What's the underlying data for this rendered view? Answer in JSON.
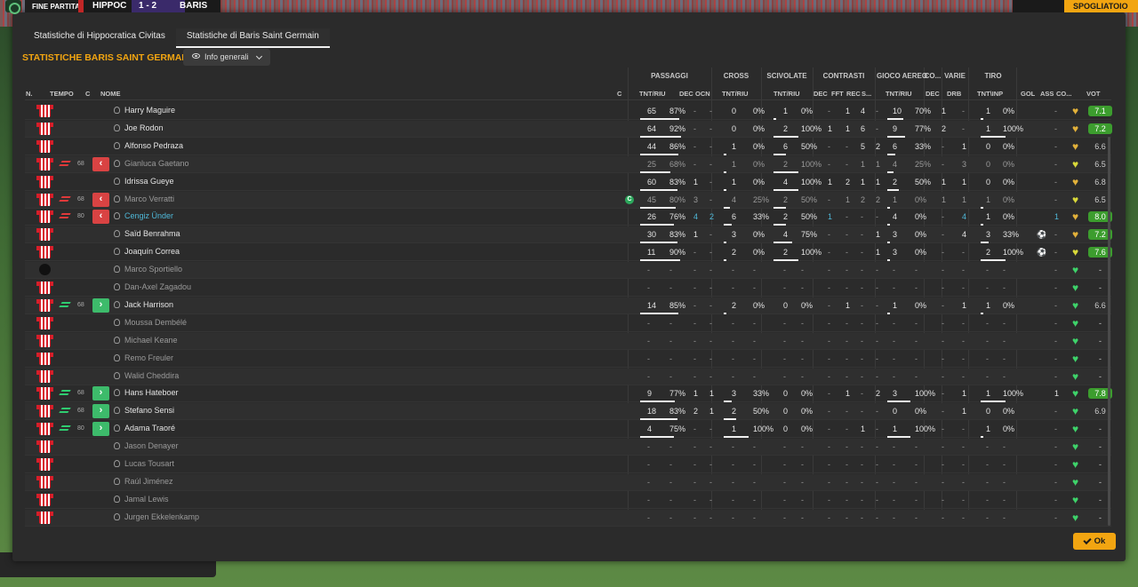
{
  "topbar": {
    "status": "FINE PARTITA",
    "home": "HIPPOC",
    "score": "1 - 2",
    "away": "BARIS",
    "right_btn": "SPOGLIATOIO"
  },
  "tabs": [
    {
      "label": "Statistiche di Hippocratica Civitas"
    },
    {
      "label": "Statistiche di Baris Saint Germain"
    }
  ],
  "title": "STATISTICHE BARIS SAINT GERMAIN",
  "dropdown": {
    "label": "Info generali"
  },
  "groups": [
    "PASSAGGI",
    "CROSS",
    "SCIVOLATE",
    "CONTRASTI",
    "GIOCO AEREO",
    "CO...",
    "VARIE",
    "TIRO"
  ],
  "headers": {
    "n": "N.",
    "tempo": "TEMPO",
    "c": "C",
    "nome": "NOME",
    "c2": "C",
    "pass": "TNT/RIU",
    "dec": "DEC",
    "ocn": "OCN",
    "cross": "TNT/RIU",
    "sciv": "TNT/RIU",
    "cdec": "DEC",
    "fft": "FFT",
    "rec": "REC",
    "s": "S...",
    "aereo": "TNT/RIU",
    "codec": "DEC",
    "drb": "DRB",
    "tiro": "TNT\\INP",
    "gol": "GOL",
    "ass": "ASS",
    "co": "CO...",
    "vot": "VOT"
  },
  "ok_label": "Ok",
  "players": [
    {
      "name": "Harry Maguire",
      "sub": "",
      "min": "",
      "pass": [
        "65",
        "87%"
      ],
      "dec": "-",
      "ocn": "-",
      "cross": [
        "0",
        "0%"
      ],
      "sciv": [
        "1",
        "0%"
      ],
      "cdec": "-",
      "fft": "1",
      "rec": "4",
      "s": "-",
      "air": [
        "10",
        "70%"
      ],
      "codec": "1",
      "drb": "-",
      "tiro": [
        "1",
        "0%"
      ],
      "gol": "",
      "ass": "-",
      "hc": "#e2b13a",
      "vot": "7.1",
      "vc": "good"
    },
    {
      "name": "Joe Rodon",
      "sub": "",
      "min": "",
      "pass": [
        "64",
        "92%"
      ],
      "dec": "-",
      "ocn": "-",
      "cross": [
        "0",
        "0%"
      ],
      "sciv": [
        "2",
        "100%"
      ],
      "cdec": "1",
      "fft": "1",
      "rec": "6",
      "s": "-",
      "air": [
        "9",
        "77%"
      ],
      "codec": "2",
      "drb": "-",
      "tiro": [
        "1",
        "100%"
      ],
      "gol": "",
      "ass": "-",
      "hc": "#e2b13a",
      "vot": "7.2",
      "vc": "good"
    },
    {
      "name": "Alfonso Pedraza",
      "sub": "",
      "min": "",
      "pass": [
        "44",
        "86%"
      ],
      "dec": "-",
      "ocn": "-",
      "cross": [
        "1",
        "0%"
      ],
      "sciv": [
        "6",
        "50%"
      ],
      "cdec": "-",
      "fft": "-",
      "rec": "5",
      "s": "2",
      "air": [
        "6",
        "33%"
      ],
      "codec": "-",
      "drb": "1",
      "tiro": [
        "0",
        "0%"
      ],
      "gol": "",
      "ass": "-",
      "hc": "#e2b13a",
      "vot": "6.6",
      "vc": "mid"
    },
    {
      "name": "Gianluca Gaetano",
      "sub": "out",
      "min": "68",
      "pass": [
        "25",
        "68%"
      ],
      "dec": "-",
      "ocn": "-",
      "cross": [
        "1",
        "0%"
      ],
      "sciv": [
        "2",
        "100%"
      ],
      "cdec": "-",
      "fft": "-",
      "rec": "1",
      "s": "1",
      "air": [
        "4",
        "25%"
      ],
      "codec": "-",
      "drb": "3",
      "tiro": [
        "0",
        "0%"
      ],
      "gol": "",
      "ass": "-",
      "hc": "#d9d93a",
      "vot": "6.5",
      "vc": "mid"
    },
    {
      "name": "Idrissa Gueye",
      "sub": "",
      "min": "",
      "pass": [
        "60",
        "83%"
      ],
      "dec": "1",
      "ocn": "-",
      "cross": [
        "1",
        "0%"
      ],
      "sciv": [
        "4",
        "100%"
      ],
      "cdec": "1",
      "fft": "2",
      "rec": "1",
      "s": "1",
      "air": [
        "2",
        "50%"
      ],
      "codec": "1",
      "drb": "1",
      "tiro": [
        "0",
        "0%"
      ],
      "gol": "",
      "ass": "-",
      "hc": "#e2b13a",
      "vot": "6.8",
      "vc": "mid"
    },
    {
      "name": "Marco Verratti",
      "sub": "out",
      "min": "68",
      "pass": [
        "45",
        "80%"
      ],
      "dec": "3",
      "ocn": "-",
      "cross": [
        "4",
        "25%"
      ],
      "sciv": [
        "2",
        "50%"
      ],
      "cdec": "-",
      "fft": "1",
      "rec": "2",
      "s": "2",
      "air": [
        "1",
        "0%"
      ],
      "codec": "1",
      "drb": "1",
      "tiro": [
        "1",
        "0%"
      ],
      "gol": "",
      "ass": "-",
      "hc": "#d9d93a",
      "vot": "6.5",
      "vc": "mid"
    },
    {
      "name": "Cengiz Ünder",
      "sub": "out",
      "min": "80",
      "pass": [
        "26",
        "76%"
      ],
      "dec": "4",
      "ocn": "2",
      "cross": [
        "6",
        "33%"
      ],
      "sciv": [
        "2",
        "50%"
      ],
      "cdec": "1",
      "fft": "-",
      "rec": "-",
      "s": "-",
      "air": [
        "4",
        "0%"
      ],
      "codec": "-",
      "drb": "4",
      "tiro": [
        "1",
        "0%"
      ],
      "gol": "",
      "ass": "1",
      "hc": "#e2b13a",
      "vot": "8.0",
      "vc": "good"
    },
    {
      "name": "Saïd Benrahma",
      "sub": "",
      "min": "",
      "pass": [
        "30",
        "83%"
      ],
      "dec": "1",
      "ocn": "-",
      "cross": [
        "3",
        "0%"
      ],
      "sciv": [
        "4",
        "75%"
      ],
      "cdec": "-",
      "fft": "-",
      "rec": "-",
      "s": "1",
      "air": [
        "3",
        "0%"
      ],
      "codec": "-",
      "drb": "4",
      "tiro": [
        "3",
        "33%"
      ],
      "gol": "⚽",
      "ass": "-",
      "hc": "#e2b13a",
      "vot": "7.2",
      "vc": "good"
    },
    {
      "name": "Joaquín Correa",
      "sub": "",
      "min": "",
      "pass": [
        "11",
        "90%"
      ],
      "dec": "-",
      "ocn": "-",
      "cross": [
        "2",
        "0%"
      ],
      "sciv": [
        "2",
        "100%"
      ],
      "cdec": "-",
      "fft": "-",
      "rec": "-",
      "s": "1",
      "air": [
        "3",
        "0%"
      ],
      "codec": "-",
      "drb": "-",
      "tiro": [
        "2",
        "100%"
      ],
      "gol": "⚽",
      "ass": "-",
      "hc": "#d9d93a",
      "vot": "7.6",
      "vc": "good"
    },
    {
      "name": "Marco Sportiello",
      "sub": "",
      "min": "",
      "pass": [
        "-",
        "-"
      ],
      "dec": "-",
      "ocn": "-",
      "cross": [
        "-",
        "-"
      ],
      "sciv": [
        "-",
        "-"
      ],
      "cdec": "-",
      "fft": "-",
      "rec": "-",
      "s": "-",
      "air": [
        "-",
        "-"
      ],
      "codec": "-",
      "drb": "-",
      "tiro": [
        "-",
        "-"
      ],
      "gol": "",
      "ass": "-",
      "hc": "#3ed36a",
      "vot": "-",
      "vc": "mid",
      "gk": "12"
    },
    {
      "name": "Dan-Axel Zagadou",
      "sub": "",
      "min": "",
      "pass": [
        "-",
        "-"
      ],
      "dec": "-",
      "ocn": "-",
      "cross": [
        "-",
        "-"
      ],
      "sciv": [
        "-",
        "-"
      ],
      "cdec": "-",
      "fft": "-",
      "rec": "-",
      "s": "-",
      "air": [
        "-",
        "-"
      ],
      "codec": "-",
      "drb": "-",
      "tiro": [
        "-",
        "-"
      ],
      "gol": "",
      "ass": "-",
      "hc": "#3ed36a",
      "vot": "-",
      "vc": "mid"
    },
    {
      "name": "Jack Harrison",
      "sub": "in",
      "min": "68",
      "pass": [
        "14",
        "85%"
      ],
      "dec": "-",
      "ocn": "-",
      "cross": [
        "2",
        "0%"
      ],
      "sciv": [
        "0",
        "0%"
      ],
      "cdec": "-",
      "fft": "1",
      "rec": "-",
      "s": "-",
      "air": [
        "1",
        "0%"
      ],
      "codec": "-",
      "drb": "1",
      "tiro": [
        "1",
        "0%"
      ],
      "gol": "",
      "ass": "-",
      "hc": "#3ed36a",
      "vot": "6.6",
      "vc": "mid"
    },
    {
      "name": "Moussa Dembélé",
      "sub": "",
      "min": "",
      "pass": [
        "-",
        "-"
      ],
      "dec": "-",
      "ocn": "-",
      "cross": [
        "-",
        "-"
      ],
      "sciv": [
        "-",
        "-"
      ],
      "cdec": "-",
      "fft": "-",
      "rec": "-",
      "s": "-",
      "air": [
        "-",
        "-"
      ],
      "codec": "-",
      "drb": "-",
      "tiro": [
        "-",
        "-"
      ],
      "gol": "",
      "ass": "-",
      "hc": "#3ed36a",
      "vot": "-",
      "vc": "mid"
    },
    {
      "name": "Michael Keane",
      "sub": "",
      "min": "",
      "pass": [
        "-",
        "-"
      ],
      "dec": "-",
      "ocn": "-",
      "cross": [
        "-",
        "-"
      ],
      "sciv": [
        "-",
        "-"
      ],
      "cdec": "-",
      "fft": "-",
      "rec": "-",
      "s": "-",
      "air": [
        "-",
        "-"
      ],
      "codec": "-",
      "drb": "-",
      "tiro": [
        "-",
        "-"
      ],
      "gol": "",
      "ass": "-",
      "hc": "#3ed36a",
      "vot": "-",
      "vc": "mid"
    },
    {
      "name": "Remo Freuler",
      "sub": "",
      "min": "",
      "pass": [
        "-",
        "-"
      ],
      "dec": "-",
      "ocn": "-",
      "cross": [
        "-",
        "-"
      ],
      "sciv": [
        "-",
        "-"
      ],
      "cdec": "-",
      "fft": "-",
      "rec": "-",
      "s": "-",
      "air": [
        "-",
        "-"
      ],
      "codec": "-",
      "drb": "-",
      "tiro": [
        "-",
        "-"
      ],
      "gol": "",
      "ass": "-",
      "hc": "#3ed36a",
      "vot": "-",
      "vc": "mid"
    },
    {
      "name": "Walid Cheddira",
      "sub": "",
      "min": "",
      "pass": [
        "-",
        "-"
      ],
      "dec": "-",
      "ocn": "-",
      "cross": [
        "-",
        "-"
      ],
      "sciv": [
        "-",
        "-"
      ],
      "cdec": "-",
      "fft": "-",
      "rec": "-",
      "s": "-",
      "air": [
        "-",
        "-"
      ],
      "codec": "-",
      "drb": "-",
      "tiro": [
        "-",
        "-"
      ],
      "gol": "",
      "ass": "-",
      "hc": "#3ed36a",
      "vot": "-",
      "vc": "mid"
    },
    {
      "name": "Hans Hateboer",
      "sub": "in",
      "min": "68",
      "pass": [
        "9",
        "77%"
      ],
      "dec": "1",
      "ocn": "1",
      "cross": [
        "3",
        "33%"
      ],
      "sciv": [
        "0",
        "0%"
      ],
      "cdec": "-",
      "fft": "1",
      "rec": "-",
      "s": "2",
      "air": [
        "3",
        "100%"
      ],
      "codec": "-",
      "drb": "1",
      "tiro": [
        "1",
        "100%"
      ],
      "gol": "",
      "ass": "1",
      "hc": "#3ed36a",
      "vot": "7.8",
      "vc": "good"
    },
    {
      "name": "Stefano Sensi",
      "sub": "in",
      "min": "68",
      "pass": [
        "18",
        "83%"
      ],
      "dec": "2",
      "ocn": "1",
      "cross": [
        "2",
        "50%"
      ],
      "sciv": [
        "0",
        "0%"
      ],
      "cdec": "-",
      "fft": "-",
      "rec": "-",
      "s": "-",
      "air": [
        "0",
        "0%"
      ],
      "codec": "-",
      "drb": "1",
      "tiro": [
        "0",
        "0%"
      ],
      "gol": "",
      "ass": "-",
      "hc": "#3ed36a",
      "vot": "6.9",
      "vc": "mid"
    },
    {
      "name": "Adama Traoré",
      "sub": "in",
      "min": "80",
      "pass": [
        "4",
        "75%"
      ],
      "dec": "-",
      "ocn": "-",
      "cross": [
        "1",
        "100%"
      ],
      "sciv": [
        "0",
        "0%"
      ],
      "cdec": "-",
      "fft": "-",
      "rec": "1",
      "s": "-",
      "air": [
        "1",
        "100%"
      ],
      "codec": "-",
      "drb": "-",
      "tiro": [
        "1",
        "0%"
      ],
      "gol": "",
      "ass": "-",
      "hc": "#3ed36a",
      "vot": "-",
      "vc": "mid"
    },
    {
      "name": "Jason Denayer",
      "sub": "",
      "min": "",
      "pass": [
        "-",
        "-"
      ],
      "dec": "-",
      "ocn": "-",
      "cross": [
        "-",
        "-"
      ],
      "sciv": [
        "-",
        "-"
      ],
      "cdec": "-",
      "fft": "-",
      "rec": "-",
      "s": "-",
      "air": [
        "-",
        "-"
      ],
      "codec": "-",
      "drb": "-",
      "tiro": [
        "-",
        "-"
      ],
      "gol": "",
      "ass": "-",
      "hc": "#3ed36a",
      "vot": "-",
      "vc": "mid"
    },
    {
      "name": "Lucas Tousart",
      "sub": "",
      "min": "",
      "pass": [
        "-",
        "-"
      ],
      "dec": "-",
      "ocn": "-",
      "cross": [
        "-",
        "-"
      ],
      "sciv": [
        "-",
        "-"
      ],
      "cdec": "-",
      "fft": "-",
      "rec": "-",
      "s": "-",
      "air": [
        "-",
        "-"
      ],
      "codec": "-",
      "drb": "-",
      "tiro": [
        "-",
        "-"
      ],
      "gol": "",
      "ass": "-",
      "hc": "#3ed36a",
      "vot": "-",
      "vc": "mid"
    },
    {
      "name": "Raúl Jiménez",
      "sub": "",
      "min": "",
      "pass": [
        "-",
        "-"
      ],
      "dec": "-",
      "ocn": "-",
      "cross": [
        "-",
        "-"
      ],
      "sciv": [
        "-",
        "-"
      ],
      "cdec": "-",
      "fft": "-",
      "rec": "-",
      "s": "-",
      "air": [
        "-",
        "-"
      ],
      "codec": "-",
      "drb": "-",
      "tiro": [
        "-",
        "-"
      ],
      "gol": "",
      "ass": "-",
      "hc": "#3ed36a",
      "vot": "-",
      "vc": "mid"
    },
    {
      "name": "Jamal Lewis",
      "sub": "",
      "min": "",
      "pass": [
        "-",
        "-"
      ],
      "dec": "-",
      "ocn": "-",
      "cross": [
        "-",
        "-"
      ],
      "sciv": [
        "-",
        "-"
      ],
      "cdec": "-",
      "fft": "-",
      "rec": "-",
      "s": "-",
      "air": [
        "-",
        "-"
      ],
      "codec": "-",
      "drb": "-",
      "tiro": [
        "-",
        "-"
      ],
      "gol": "",
      "ass": "-",
      "hc": "#3ed36a",
      "vot": "-",
      "vc": "mid"
    },
    {
      "name": "Jurgen Ekkelenkamp",
      "sub": "",
      "min": "",
      "pass": [
        "-",
        "-"
      ],
      "dec": "-",
      "ocn": "-",
      "cross": [
        "-",
        "-"
      ],
      "sciv": [
        "-",
        "-"
      ],
      "cdec": "-",
      "fft": "-",
      "rec": "-",
      "s": "-",
      "air": [
        "-",
        "-"
      ],
      "codec": "-",
      "drb": "-",
      "tiro": [
        "-",
        "-"
      ],
      "gol": "",
      "ass": "-",
      "hc": "#3ed36a",
      "vot": "-",
      "vc": "mid"
    }
  ]
}
